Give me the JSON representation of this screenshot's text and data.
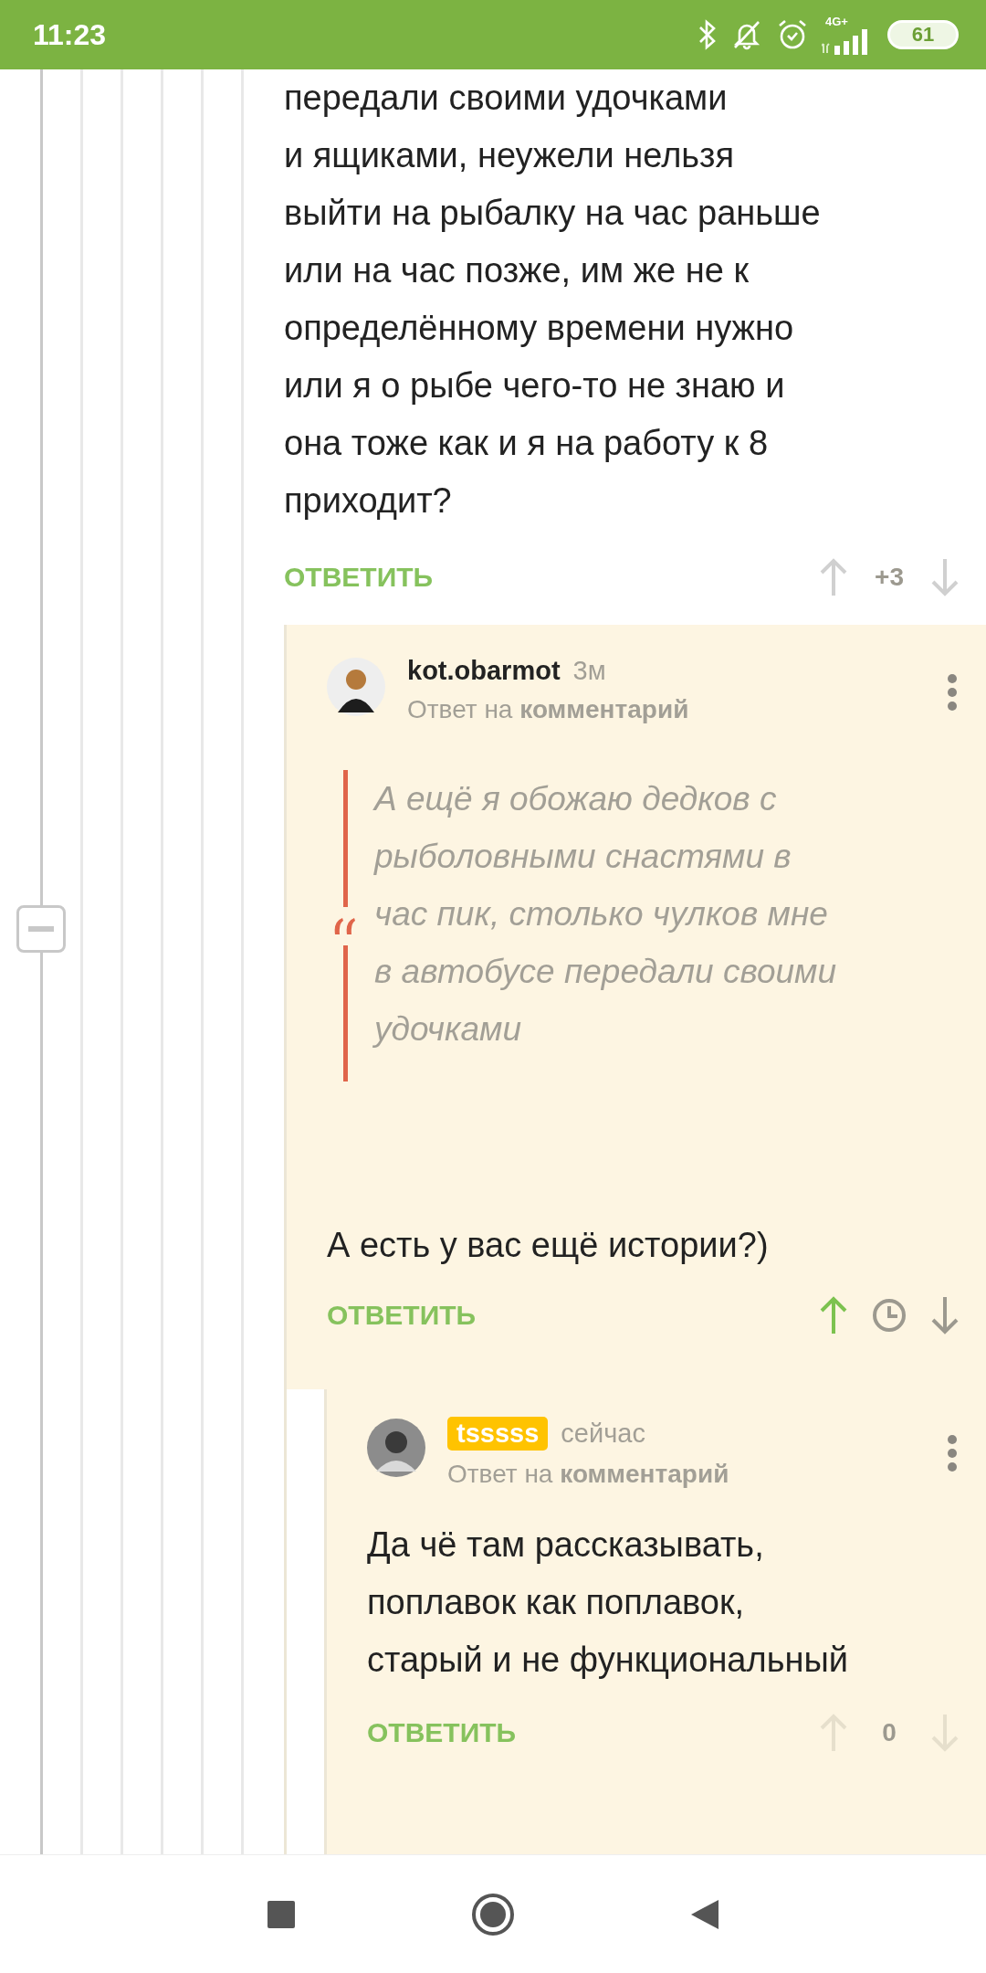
{
  "status_bar": {
    "time": "11:23",
    "network": "4G+",
    "battery": "61"
  },
  "comments": [
    {
      "unread": false,
      "text": "передали своими удочками\nи ящиками, неужели нельзя\nвыйти на рыбалку на час раньше\nили на час позже, им же не к\nопределённому времени нужно\nили я о рыбе чего-то не знаю и\nона тоже как и я на работу к 8\nприходит?",
      "reply_label": "ОТВЕТИТЬ",
      "upvoted": false,
      "score": "+3",
      "children": [
        {
          "unread": true,
          "author": "kot.obarmot",
          "author_highlighted": false,
          "time": "3м",
          "reply_to": "Ответ на **комментарий**",
          "quote": "А ещё я обожаю дедков с\nрыболовными снастями в\nчас пик, столько чулков мне\nв автобусе передали своими\nудочками",
          "text": "А есть у вас ещё истории?)",
          "reply_label": "ОТВЕТИТЬ",
          "upvoted": true,
          "children": [
            {
              "unread": true,
              "author": "tsssss",
              "author_highlighted": true,
              "time": "сейчас",
              "reply_to": "Ответ на **комментарий**",
              "text": "Да чё там рассказывать,\nпоплавок как поплавок,\nстарый и не функциональный",
              "reply_label": "ОТВЕТИТЬ",
              "upvoted": false,
              "score": "0"
            }
          ]
        }
      ]
    }
  ]
}
